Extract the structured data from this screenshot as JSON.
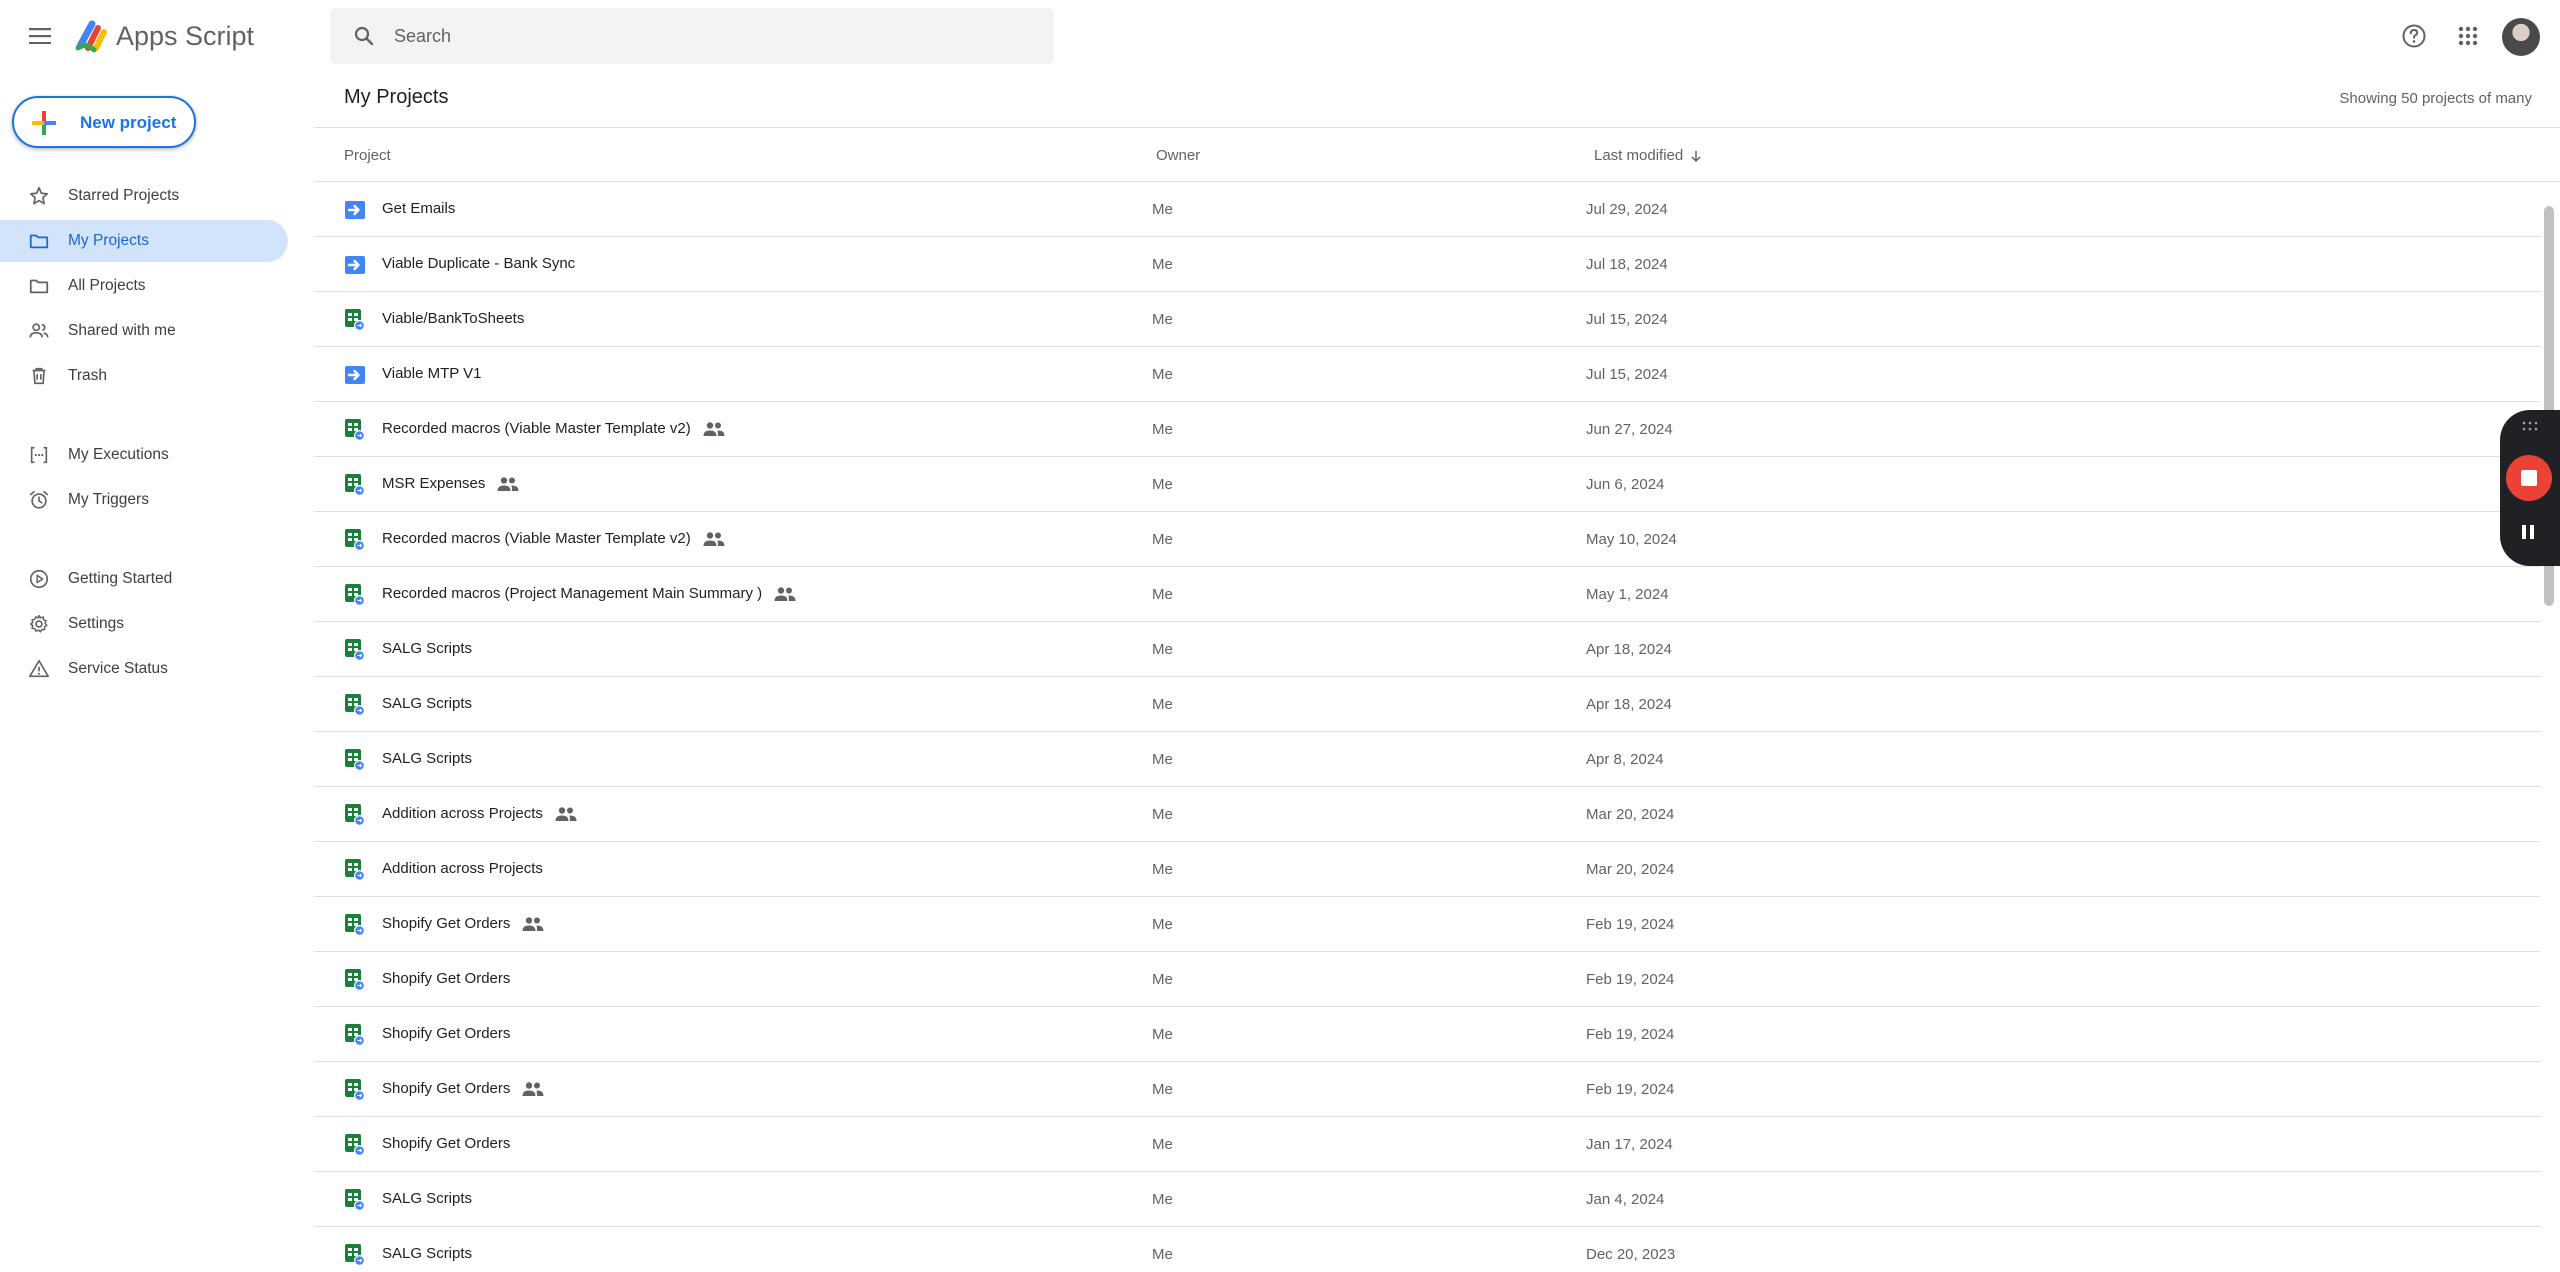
{
  "app": {
    "title": "Apps Script"
  },
  "search": {
    "placeholder": "Search"
  },
  "sidebar": {
    "new_project_label": "New project",
    "items": [
      {
        "label": "Starred Projects",
        "icon": "star-icon"
      },
      {
        "label": "My Projects",
        "icon": "folder-icon",
        "active": true
      },
      {
        "label": "All Projects",
        "icon": "folder-outline-icon"
      },
      {
        "label": "Shared with me",
        "icon": "people-icon"
      },
      {
        "label": "Trash",
        "icon": "trash-icon"
      },
      {
        "label": "My Executions",
        "icon": "executions-icon"
      },
      {
        "label": "My Triggers",
        "icon": "alarm-icon"
      },
      {
        "label": "Getting Started",
        "icon": "play-circle-icon"
      },
      {
        "label": "Settings",
        "icon": "gear-icon"
      },
      {
        "label": "Service Status",
        "icon": "warning-icon"
      }
    ]
  },
  "main": {
    "title": "My Projects",
    "showing": "Showing 50 projects of many",
    "columns": {
      "project": "Project",
      "owner": "Owner",
      "modified": "Last modified"
    },
    "rows": [
      {
        "name": "Get Emails",
        "owner": "Me",
        "date": "Jul 29, 2024",
        "type": "standalone",
        "shared": false
      },
      {
        "name": "Viable Duplicate - Bank Sync",
        "owner": "Me",
        "date": "Jul 18, 2024",
        "type": "standalone",
        "shared": false
      },
      {
        "name": "Viable/BankToSheets",
        "owner": "Me",
        "date": "Jul 15, 2024",
        "type": "sheets",
        "shared": false
      },
      {
        "name": "Viable MTP V1",
        "owner": "Me",
        "date": "Jul 15, 2024",
        "type": "standalone",
        "shared": false
      },
      {
        "name": "Recorded macros (Viable Master Template v2)",
        "owner": "Me",
        "date": "Jun 27, 2024",
        "type": "sheets",
        "shared": true
      },
      {
        "name": "MSR Expenses",
        "owner": "Me",
        "date": "Jun 6, 2024",
        "type": "sheets",
        "shared": true
      },
      {
        "name": "Recorded macros (Viable Master Template v2)",
        "owner": "Me",
        "date": "May 10, 2024",
        "type": "sheets",
        "shared": true
      },
      {
        "name": "Recorded macros (Project Management Main Summary )",
        "owner": "Me",
        "date": "May 1, 2024",
        "type": "sheets",
        "shared": true
      },
      {
        "name": "SALG Scripts",
        "owner": "Me",
        "date": "Apr 18, 2024",
        "type": "sheets",
        "shared": false
      },
      {
        "name": "SALG Scripts",
        "owner": "Me",
        "date": "Apr 18, 2024",
        "type": "sheets",
        "shared": false
      },
      {
        "name": "SALG Scripts",
        "owner": "Me",
        "date": "Apr 8, 2024",
        "type": "sheets",
        "shared": false
      },
      {
        "name": "Addition across Projects",
        "owner": "Me",
        "date": "Mar 20, 2024",
        "type": "sheets",
        "shared": true
      },
      {
        "name": "Addition across Projects",
        "owner": "Me",
        "date": "Mar 20, 2024",
        "type": "sheets",
        "shared": false
      },
      {
        "name": "Shopify Get Orders",
        "owner": "Me",
        "date": "Feb 19, 2024",
        "type": "sheets",
        "shared": true
      },
      {
        "name": "Shopify Get Orders",
        "owner": "Me",
        "date": "Feb 19, 2024",
        "type": "sheets",
        "shared": false
      },
      {
        "name": "Shopify Get Orders",
        "owner": "Me",
        "date": "Feb 19, 2024",
        "type": "sheets",
        "shared": false
      },
      {
        "name": "Shopify Get Orders",
        "owner": "Me",
        "date": "Feb 19, 2024",
        "type": "sheets",
        "shared": true
      },
      {
        "name": "Shopify Get Orders",
        "owner": "Me",
        "date": "Jan 17, 2024",
        "type": "sheets",
        "shared": false
      },
      {
        "name": "SALG Scripts",
        "owner": "Me",
        "date": "Jan 4, 2024",
        "type": "sheets",
        "shared": false
      },
      {
        "name": "SALG Scripts",
        "owner": "Me",
        "date": "Dec 20, 2023",
        "type": "sheets",
        "shared": false
      }
    ]
  },
  "colors": {
    "accent": "#1a73e8",
    "active_bg": "#d2e3fc",
    "sheets_green": "#188038",
    "standalone_blue": "#4285f4",
    "record_red": "#ea4335"
  }
}
